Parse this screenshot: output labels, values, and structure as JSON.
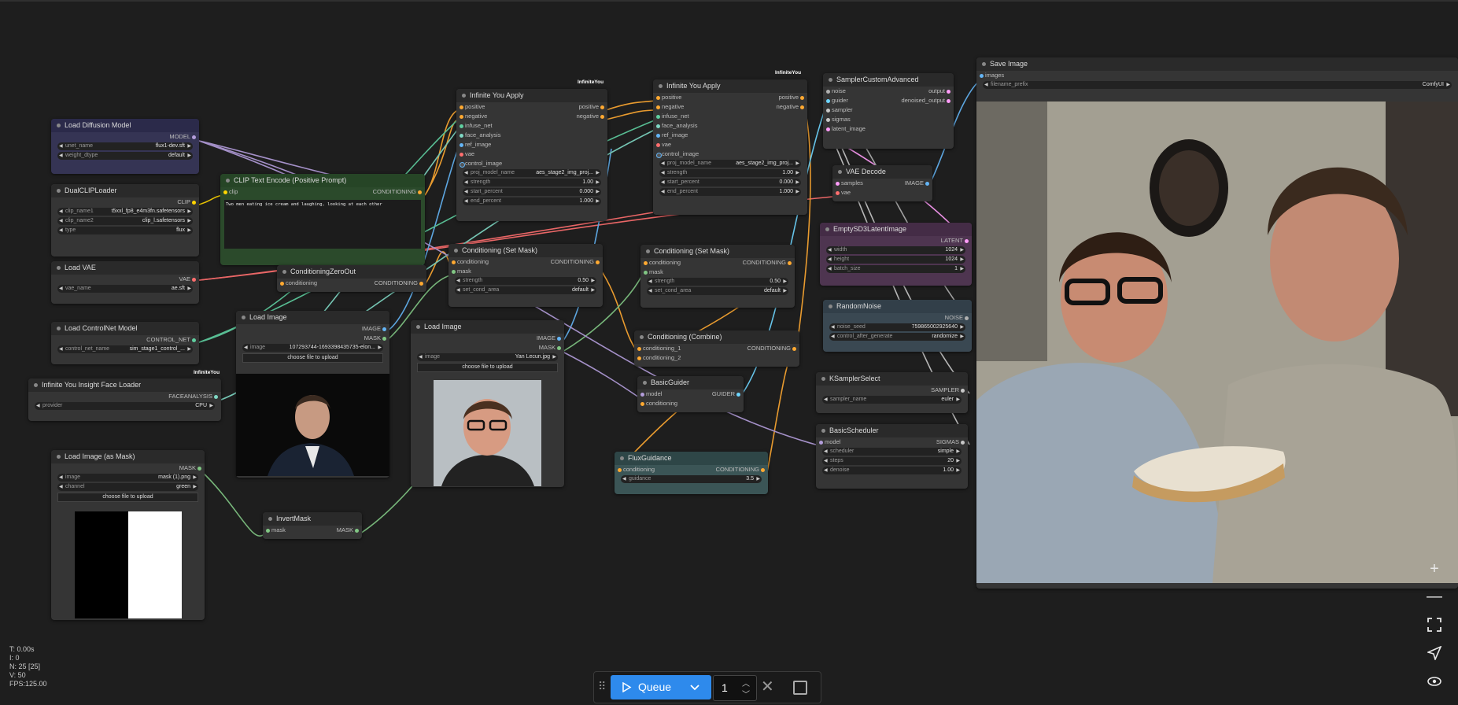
{
  "app": "ComfyUI",
  "colors": {
    "canvas": "#1e1e1e",
    "accent": "#2e8aec",
    "model": "#b39ddb",
    "clip": "#ffd500",
    "vae": "#ff6e6e",
    "conditioning": "#ffa931",
    "image": "#64b5f6",
    "mask": "#81c784",
    "latent": "#ff9cf9"
  },
  "nodes": {
    "load_diffusion": {
      "title": "Load Diffusion Model",
      "out_model": "MODEL",
      "unet_label": "unet_name",
      "unet_value": "flux1-dev.sft",
      "dtype_label": "weight_dtype",
      "dtype_value": "default"
    },
    "dual_clip": {
      "title": "DualCLIPLoader",
      "out_clip": "CLIP",
      "c1_label": "clip_name1",
      "c1_value": "t5xxl_fp8_e4m3fn.safetensors",
      "c2_label": "clip_name2",
      "c2_value": "clip_l.safetensors",
      "type_label": "type",
      "type_value": "flux"
    },
    "load_vae": {
      "title": "Load VAE",
      "out_vae": "VAE",
      "vae_label": "vae_name",
      "vae_value": "ae.sft"
    },
    "load_controlnet": {
      "title": "Load ControlNet Model",
      "out": "CONTROL_NET",
      "cn_label": "control_net_name",
      "cn_value": "sim_stage1_control_..."
    },
    "face_loader": {
      "title": "Infinite You Insight Face Loader",
      "badge": "InfiniteYou",
      "out": "FACEANALYSIS",
      "prov_label": "provider",
      "prov_value": "CPU"
    },
    "load_mask": {
      "title": "Load Image (as Mask)",
      "out": "MASK",
      "image_label": "image",
      "image_value": "mask (1).png",
      "channel_label": "channel",
      "channel_value": "green",
      "upload": "choose file to upload"
    },
    "invert_mask": {
      "title": "InvertMask",
      "in": "mask",
      "out": "MASK"
    },
    "clip_text": {
      "title": "CLIP Text Encode (Positive Prompt)",
      "in": "clip",
      "out": "CONDITIONING",
      "prompt": "Two men eating ice cream and laughing, looking at each other"
    },
    "cond_zero": {
      "title": "ConditioningZeroOut",
      "in": "conditioning",
      "out": "CONDITIONING"
    },
    "load_image_1": {
      "title": "Load Image",
      "out_image": "IMAGE",
      "out_mask": "MASK",
      "image_label": "image",
      "image_value": "107293744-1693398435735-elon...",
      "upload": "choose file to upload"
    },
    "load_image_2": {
      "title": "Load Image",
      "out_image": "IMAGE",
      "out_mask": "MASK",
      "image_label": "image",
      "image_value": "Yan Lecun.jpg",
      "upload": "choose file to upload"
    },
    "iy_apply_1": {
      "title": "Infinite You Apply",
      "badge": "InfiniteYou",
      "inputs": [
        "positive",
        "negative",
        "infuse_net",
        "face_analysis",
        "ref_image",
        "vae",
        "control_image"
      ],
      "out_pos": "positive",
      "out_neg": "negative",
      "w_model_label": "proj_model_name",
      "w_model_value": "aes_stage2_img_proj...",
      "w_strength_label": "strength",
      "w_strength_value": "1.00",
      "w_start_label": "start_percent",
      "w_start_value": "0.000",
      "w_end_label": "end_percent",
      "w_end_value": "1.000"
    },
    "iy_apply_2": {
      "title": "Infinite You Apply",
      "badge": "InfiniteYou",
      "inputs": [
        "positive",
        "negative",
        "infuse_net",
        "face_analysis",
        "ref_image",
        "vae",
        "control_image"
      ],
      "out_pos": "positive",
      "out_neg": "negative",
      "w_model_label": "proj_model_name",
      "w_model_value": "aes_stage2_img_proj...",
      "w_strength_label": "strength",
      "w_strength_value": "1.00",
      "w_start_label": "start_percent",
      "w_start_value": "0.000",
      "w_end_label": "end_percent",
      "w_end_value": "1.000"
    },
    "cond_mask_1": {
      "title": "Conditioning (Set Mask)",
      "in1": "conditioning",
      "in2": "mask",
      "out": "CONDITIONING",
      "s_label": "strength",
      "s_value": "0.50",
      "a_label": "set_cond_area",
      "a_value": "default"
    },
    "cond_mask_2": {
      "title": "Conditioning (Set Mask)",
      "in1": "conditioning",
      "in2": "mask",
      "out": "CONDITIONING",
      "s_label": "strength",
      "s_value": "0.50",
      "a_label": "set_cond_area",
      "a_value": "default"
    },
    "cond_combine": {
      "title": "Conditioning (Combine)",
      "in1": "conditioning_1",
      "in2": "conditioning_2",
      "out": "CONDITIONING"
    },
    "basic_guider": {
      "title": "BasicGuider",
      "in1": "model",
      "in2": "conditioning",
      "out": "GUIDER"
    },
    "flux_guidance": {
      "title": "FluxGuidance",
      "in": "conditioning",
      "out": "CONDITIONING",
      "g_label": "guidance",
      "g_value": "3.5"
    },
    "sampler_adv": {
      "title": "SamplerCustomAdvanced",
      "inputs": [
        "noise",
        "guider",
        "sampler",
        "sigmas",
        "latent_image"
      ],
      "out1": "output",
      "out2": "denoised_output"
    },
    "vae_decode": {
      "title": "VAE Decode",
      "in1": "samples",
      "in2": "vae",
      "out": "IMAGE"
    },
    "empty_latent": {
      "title": "EmptySD3LatentImage",
      "out": "LATENT",
      "w_label": "width",
      "w_value": "1024",
      "h_label": "height",
      "h_value": "1024",
      "b_label": "batch_size",
      "b_value": "1"
    },
    "random_noise": {
      "title": "RandomNoise",
      "out": "NOISE",
      "seed_label": "noise_seed",
      "seed_value": "759865002925640",
      "cag_label": "control_after_generate",
      "cag_value": "randomize"
    },
    "ksampler_select": {
      "title": "KSamplerSelect",
      "out": "SAMPLER",
      "s_label": "sampler_name",
      "s_value": "euler"
    },
    "basic_scheduler": {
      "title": "BasicScheduler",
      "in": "model",
      "out": "SIGMAS",
      "sch_label": "scheduler",
      "sch_value": "simple",
      "steps_label": "steps",
      "steps_value": "20",
      "den_label": "denoise",
      "den_value": "1.00"
    },
    "save_image": {
      "title": "Save Image",
      "in": "images",
      "fp_label": "filename_prefix",
      "fp_value": "ComfyUI"
    }
  },
  "stats": {
    "t": "T: 0.00s",
    "i": "I: 0",
    "n": "N: 25 [25]",
    "v": "V: 50",
    "fps": "FPS:125.00"
  },
  "toolbar": {
    "queue_label": "Queue",
    "batch_count": "1"
  },
  "right_buttons": [
    "zoom-in",
    "zoom-out",
    "fit-view",
    "locate",
    "toggle-visibility"
  ]
}
